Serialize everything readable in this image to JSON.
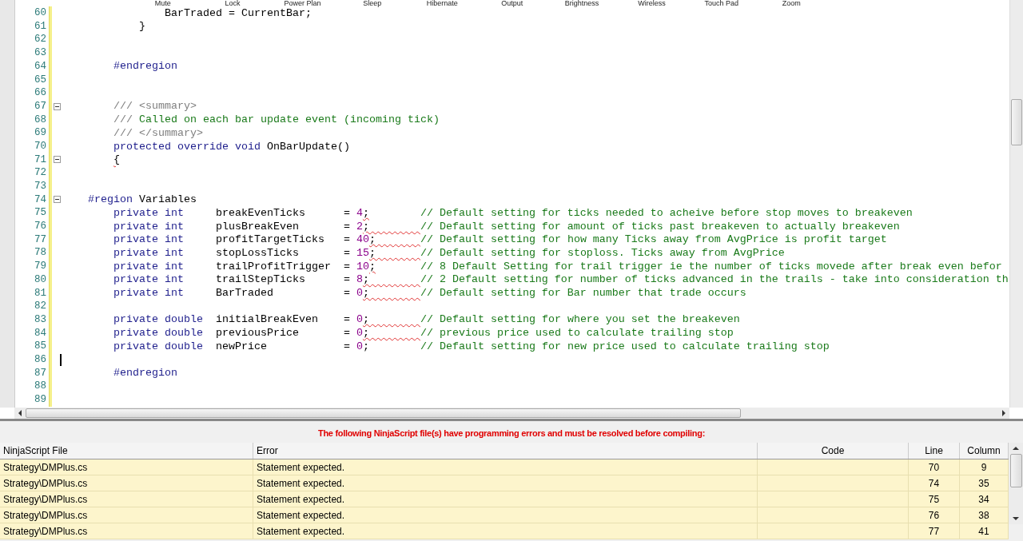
{
  "overlay_labels": [
    "Mute",
    "Lock",
    "Power Plan",
    "Sleep",
    "Hibernate",
    "Output",
    "Brightness",
    "Wireless",
    "Touch Pad",
    "Zoom"
  ],
  "editor": {
    "lines": [
      {
        "number": "60",
        "segments": [
          {
            "text": "                BarTraded = CurrentBar;",
            "kind": "plain"
          }
        ]
      },
      {
        "number": "61",
        "segments": [
          {
            "text": "            }",
            "kind": "plain"
          }
        ]
      },
      {
        "number": "62"
      },
      {
        "number": "63"
      },
      {
        "number": "64",
        "segments": [
          {
            "text": "        #endregion",
            "kind": "kw"
          }
        ]
      },
      {
        "number": "65"
      },
      {
        "number": "66"
      },
      {
        "number": "67",
        "fold_expanded": true,
        "segments": [
          {
            "text": "        /// <summary>",
            "kind": "doc"
          }
        ]
      },
      {
        "number": "68",
        "segments": [
          {
            "text": "        /// ",
            "kind": "doc"
          },
          {
            "text": "Called on each bar update event (incoming tick)",
            "kind": "comment"
          }
        ]
      },
      {
        "number": "69",
        "segments": [
          {
            "text": "        /// </summary>",
            "kind": "doc"
          }
        ]
      },
      {
        "number": "70",
        "segments": [
          {
            "text": "        protected override void",
            "kind": "kw"
          },
          {
            "text": " OnBarUpdate()",
            "kind": "plain"
          }
        ]
      },
      {
        "number": "71",
        "fold_expanded": true,
        "segments": [
          {
            "text": "        {",
            "kind": "plain",
            "squiggle": true
          }
        ]
      },
      {
        "number": "72"
      },
      {
        "number": "73"
      },
      {
        "number": "74",
        "fold_expanded": true,
        "segments": [
          {
            "text": "    #region",
            "kind": "kw"
          },
          {
            "text": " Variables",
            "kind": "plain"
          }
        ]
      },
      {
        "number": "75",
        "segments": [
          {
            "text": "        private int",
            "kind": "kw"
          },
          {
            "text": "     breakEvenTicks      = ",
            "kind": "plain"
          },
          {
            "text": "4",
            "kind": "num"
          },
          {
            "text": ";",
            "kind": "plain",
            "squiggle": true
          },
          {
            "text": "        // Default setting for ticks needed to acheive before stop moves to breakeven",
            "kind": "comment"
          }
        ]
      },
      {
        "number": "76",
        "segments": [
          {
            "text": "        private int",
            "kind": "kw"
          },
          {
            "text": "     plusBreakEven       = ",
            "kind": "plain"
          },
          {
            "text": "2",
            "kind": "num"
          },
          {
            "text": ";        ",
            "kind": "plain",
            "squiggle": true
          },
          {
            "text": "// Default setting for amount of ticks past breakeven to actually breakeven",
            "kind": "comment"
          }
        ]
      },
      {
        "number": "77",
        "segments": [
          {
            "text": "        private int",
            "kind": "kw"
          },
          {
            "text": "     profitTargetTicks   = ",
            "kind": "plain"
          },
          {
            "text": "40",
            "kind": "num"
          },
          {
            "text": ";       ",
            "kind": "plain",
            "squiggle": true
          },
          {
            "text": "// Default setting for how many Ticks away from AvgPrice is profit target",
            "kind": "comment"
          }
        ]
      },
      {
        "number": "78",
        "segments": [
          {
            "text": "        private int",
            "kind": "kw"
          },
          {
            "text": "     stopLossTicks       = ",
            "kind": "plain"
          },
          {
            "text": "15",
            "kind": "num"
          },
          {
            "text": ";       ",
            "kind": "plain",
            "squiggle": true
          },
          {
            "text": "// Default setting for stoploss. Ticks away from AvgPrice",
            "kind": "comment"
          }
        ]
      },
      {
        "number": "79",
        "segments": [
          {
            "text": "        private int",
            "kind": "kw"
          },
          {
            "text": "     trailProfitTrigger  = ",
            "kind": "plain"
          },
          {
            "text": "10",
            "kind": "num"
          },
          {
            "text": ";",
            "kind": "plain",
            "squiggle": true
          },
          {
            "text": "       // 8 Default Setting for trail trigger ie the number of ticks movede after break even befor",
            "kind": "comment"
          }
        ]
      },
      {
        "number": "80",
        "segments": [
          {
            "text": "        private int",
            "kind": "kw"
          },
          {
            "text": "     trailStepTicks      = ",
            "kind": "plain"
          },
          {
            "text": "8",
            "kind": "num"
          },
          {
            "text": ";        ",
            "kind": "plain",
            "squiggle": true
          },
          {
            "text": "// 2 Default setting for number of ticks advanced in the trails - take into consideration th",
            "kind": "comment"
          }
        ]
      },
      {
        "number": "81",
        "segments": [
          {
            "text": "        private int",
            "kind": "kw"
          },
          {
            "text": "     BarTraded           = ",
            "kind": "plain"
          },
          {
            "text": "0",
            "kind": "num"
          },
          {
            "text": ";        ",
            "kind": "plain",
            "squiggle": true
          },
          {
            "text": "// Default setting for Bar number that trade occurs",
            "kind": "comment"
          }
        ]
      },
      {
        "number": "82"
      },
      {
        "number": "83",
        "segments": [
          {
            "text": "        private double",
            "kind": "kw"
          },
          {
            "text": "  initialBreakEven    = ",
            "kind": "plain"
          },
          {
            "text": "0",
            "kind": "num"
          },
          {
            "text": ";        ",
            "kind": "plain",
            "squiggle": true
          },
          {
            "text": "// Default setting for where you set the breakeven",
            "kind": "comment"
          }
        ]
      },
      {
        "number": "84",
        "segments": [
          {
            "text": "        private double",
            "kind": "kw"
          },
          {
            "text": "  previousPrice       = ",
            "kind": "plain"
          },
          {
            "text": "0",
            "kind": "num"
          },
          {
            "text": ";        ",
            "kind": "plain",
            "squiggle": true
          },
          {
            "text": "// previous price used to calculate trailing stop",
            "kind": "comment"
          }
        ]
      },
      {
        "number": "85",
        "segments": [
          {
            "text": "        private double",
            "kind": "kw"
          },
          {
            "text": "  newPrice            = ",
            "kind": "plain"
          },
          {
            "text": "0",
            "kind": "num"
          },
          {
            "text": ";",
            "kind": "plain"
          },
          {
            "text": "        // Default setting for new price used to calculate trailing stop",
            "kind": "comment"
          }
        ]
      },
      {
        "number": "86",
        "caret": true
      },
      {
        "number": "87",
        "segments": [
          {
            "text": "        #endregion",
            "kind": "kw"
          }
        ]
      },
      {
        "number": "88"
      },
      {
        "number": "89"
      }
    ]
  },
  "error_panel": {
    "message": "The following NinjaScript file(s) have programming errors and must be resolved before compiling:",
    "columns": [
      "NinjaScript File",
      "Error",
      "Code",
      "Line",
      "Column"
    ],
    "rows": [
      {
        "file": "Strategy\\DMPlus.cs",
        "error": "Statement expected.",
        "line": "70",
        "column": "9"
      },
      {
        "file": "Strategy\\DMPlus.cs",
        "error": "Statement expected.",
        "line": "74",
        "column": "35"
      },
      {
        "file": "Strategy\\DMPlus.cs",
        "error": "Statement expected.",
        "line": "75",
        "column": "34"
      },
      {
        "file": "Strategy\\DMPlus.cs",
        "error": "Statement expected.",
        "line": "76",
        "column": "38"
      },
      {
        "file": "Strategy\\DMPlus.cs",
        "error": "Statement expected.",
        "line": "77",
        "column": "41"
      }
    ]
  }
}
